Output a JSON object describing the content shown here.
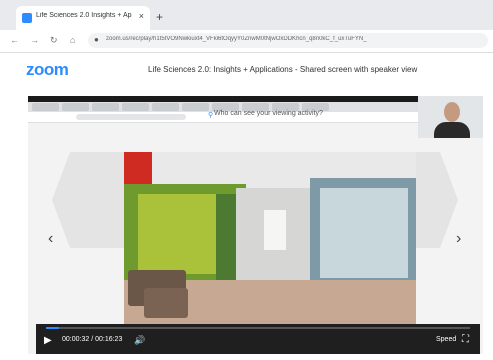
{
  "browser": {
    "tab_title": "Life Sciences 2.0 Insights + Appl",
    "tab_close": "×",
    "new_tab": "+",
    "url": "zoom.us/rec/play/h1t5tVO9Nwkiuxt4_VFki6tOqyyY0ZnwM0tNjwOxDDKhcn_q8n0kC_f_uxTuFYN_"
  },
  "page": {
    "logo": "zoom",
    "title": "Life Sciences 2.0: Insights + Applications - Shared screen with speaker view"
  },
  "player": {
    "prompt": "Who can see your viewing activity?",
    "prev": "‹",
    "next": "›",
    "time": "00:00:32 / 00:16:23",
    "speed": "Speed",
    "progress_fraction": 0.03
  }
}
